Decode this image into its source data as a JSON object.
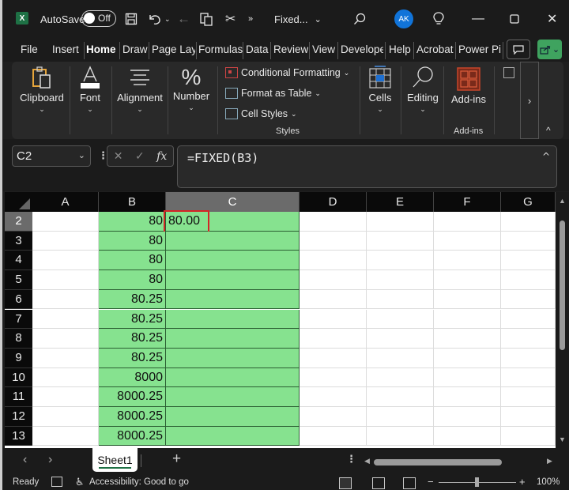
{
  "titlebar": {
    "app_icon": "excel-logo-icon",
    "app_letter": "X",
    "autosave_label": "AutoSave",
    "autosave_state": "Off",
    "file_name": "Fixed...",
    "avatar_initials": "AK",
    "quick_access": [
      "save-icon",
      "undo-icon",
      "redo-icon",
      "copy-icon",
      "cut-icon",
      "more-icon"
    ],
    "more_label": "»"
  },
  "ribbon_tabs": [
    {
      "label": "File"
    },
    {
      "label": "Insert"
    },
    {
      "label": "Home",
      "active": true
    },
    {
      "label": "Draw"
    },
    {
      "label": "Page Layout"
    },
    {
      "label": "Formulas"
    },
    {
      "label": "Data"
    },
    {
      "label": "Review"
    },
    {
      "label": "View"
    },
    {
      "label": "Developer"
    },
    {
      "label": "Help"
    },
    {
      "label": "Acrobat"
    },
    {
      "label": "Power Pivot"
    }
  ],
  "ribbon": {
    "clipboard": "Clipboard",
    "font": "Font",
    "alignment": "Alignment",
    "number": "Number",
    "conditional_formatting": "Conditional Formatting",
    "format_as_table": "Format as Table",
    "cell_styles": "Cell Styles",
    "styles_group": "Styles",
    "cells": "Cells",
    "editing": "Editing",
    "addins": "Add-ins",
    "addins_group": "Add-ins",
    "more": "›",
    "collapse": "^"
  },
  "formula_bar": {
    "name_box": "C2",
    "cancel": "✕",
    "enter": "✓",
    "fx": "fx",
    "formula": "=FIXED(B3)"
  },
  "sheet": {
    "columns": [
      "A",
      "B",
      "C",
      "D",
      "E",
      "F",
      "G"
    ],
    "selected_column": "C",
    "rows": [
      {
        "num": "2",
        "B": "80",
        "C": "80.00",
        "selected": true
      },
      {
        "num": "3",
        "B": "80",
        "C": ""
      },
      {
        "num": "4",
        "B": "80",
        "C": ""
      },
      {
        "num": "5",
        "B": "80",
        "C": ""
      },
      {
        "num": "6",
        "B": "80.25",
        "C": ""
      },
      {
        "num": "7",
        "B": "80.25",
        "C": ""
      },
      {
        "num": "8",
        "B": "80.25",
        "C": ""
      },
      {
        "num": "9",
        "B": "80.25",
        "C": ""
      },
      {
        "num": "10",
        "B": "8000",
        "C": ""
      },
      {
        "num": "11",
        "B": "8000.25",
        "C": ""
      },
      {
        "num": "12",
        "B": "8000.25",
        "C": ""
      },
      {
        "num": "13",
        "B": "8000.25",
        "C": ""
      }
    ],
    "fill_color": "#86e28f",
    "highlight_color": "#d32626"
  },
  "sheet_tabs": {
    "prev": "‹",
    "next": "›",
    "active": "Sheet1",
    "add": "+"
  },
  "status": {
    "mode": "Ready",
    "accessibility": "Accessibility: Good to go",
    "zoom": "100%",
    "zoom_minus": "−",
    "zoom_plus": "+"
  }
}
